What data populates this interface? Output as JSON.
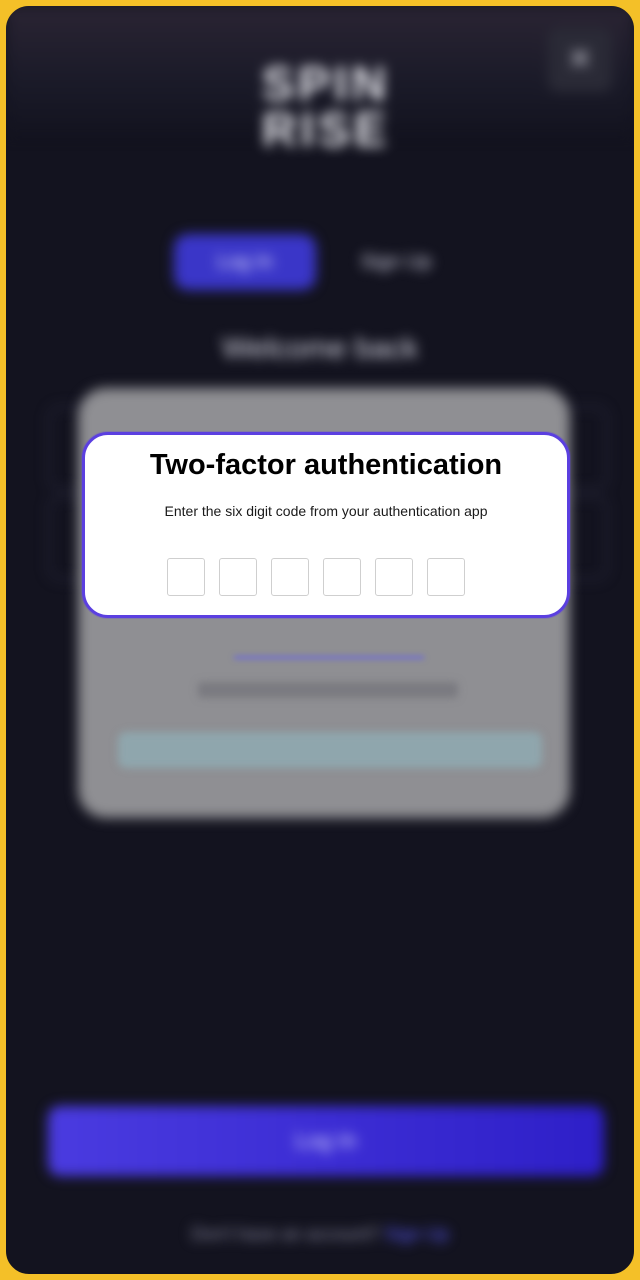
{
  "background": {
    "brand_logo_text_line1": "SPIN",
    "brand_logo_text_line2": "RISE",
    "close_icon": "close-icon",
    "tabs": [
      {
        "label": "Log In"
      },
      {
        "label": "Sign Up"
      }
    ],
    "welcome_text": "Welcome back",
    "login_button_label": "Log In",
    "footer_text": "Don't have an account?",
    "footer_link": "Sign Up"
  },
  "modal": {
    "title": "Two-factor authentication",
    "subtitle": "Enter the six digit code from your authentication app",
    "code_length": 6,
    "code_values": [
      "",
      "",
      "",
      "",
      "",
      ""
    ]
  },
  "colors": {
    "frame": "#f4c028",
    "app_background": "#13131f",
    "accent": "#5b3fe0",
    "primary_button": "#3a36c8"
  }
}
